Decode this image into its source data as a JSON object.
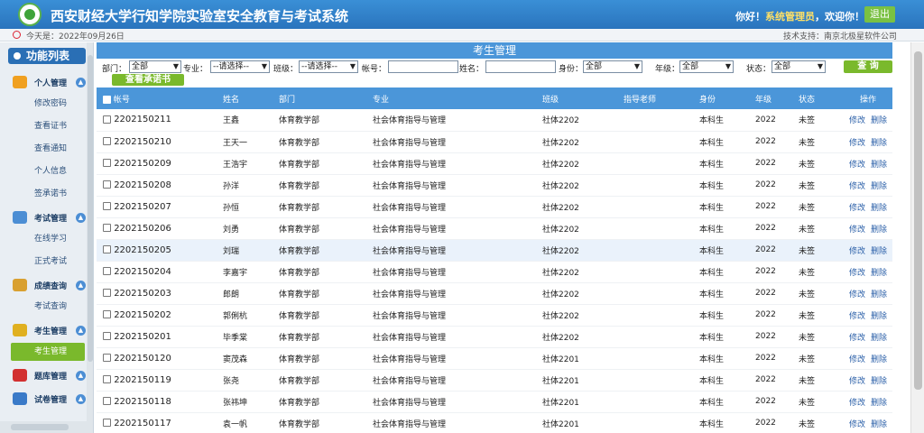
{
  "header": {
    "title": "西安财经大学行知学院实验室安全教育与考试系统",
    "greeting_prefix": "你好！",
    "role": "系统管理员",
    "greeting_suffix": "，欢迎你！",
    "logout_label": "退出"
  },
  "infobar": {
    "today": "今天是：2022年09月26日",
    "support": "技术支持：南京北极星软件公司"
  },
  "sidebar": {
    "title": "功能列表",
    "sections": [
      {
        "label": "个人管理",
        "icon": "person-pencil-icon",
        "items": [
          "修改密码",
          "查看证书",
          "查看通知",
          "个人信息",
          "签承诺书"
        ]
      },
      {
        "label": "考试管理",
        "icon": "people-exam-icon",
        "items": [
          "在线学习",
          "正式考试"
        ]
      },
      {
        "label": "成绩查询",
        "icon": "people-score-icon",
        "items": [
          "考试查询"
        ]
      },
      {
        "label": "考生管理",
        "icon": "lock-people-icon",
        "items": [
          "考生管理"
        ]
      },
      {
        "label": "题库管理",
        "icon": "question-bank-icon",
        "items": []
      },
      {
        "label": "试卷管理",
        "icon": "paper-people-icon",
        "items": []
      }
    ],
    "active_item": "考生管理"
  },
  "main": {
    "title": "考生管理",
    "filters": {
      "dept_label": "部门：",
      "dept_value": "全部",
      "major_label": "专业：",
      "major_value": "--请选择--",
      "class_label": "班级：",
      "class_value": "--请选择--",
      "account_label": "帐号：",
      "account_value": "",
      "name_label": "姓名：",
      "name_value": "",
      "identity_label": "身份：",
      "identity_value": "全部",
      "grade_label": "年级：",
      "grade_value": "全部",
      "status_label": "状态：",
      "status_value": "全部",
      "search_label": "查 询",
      "pledge_label": "查看承诺书"
    },
    "columns": [
      "帐号",
      "姓名",
      "部门",
      "专业",
      "班级",
      "指导老师",
      "身份",
      "年级",
      "状态",
      "操作"
    ],
    "edit_label": "修改",
    "delete_label": "删除",
    "rows": [
      {
        "account": "2202150211",
        "name": "王鑫",
        "dept": "体育教学部",
        "major": "社会体育指导与管理",
        "class": "社体2202",
        "tutor": "",
        "identity": "本科生",
        "grade": "2022",
        "status": "未签"
      },
      {
        "account": "2202150210",
        "name": "王天一",
        "dept": "体育教学部",
        "major": "社会体育指导与管理",
        "class": "社体2202",
        "tutor": "",
        "identity": "本科生",
        "grade": "2022",
        "status": "未签"
      },
      {
        "account": "2202150209",
        "name": "王浩宇",
        "dept": "体育教学部",
        "major": "社会体育指导与管理",
        "class": "社体2202",
        "tutor": "",
        "identity": "本科生",
        "grade": "2022",
        "status": "未签"
      },
      {
        "account": "2202150208",
        "name": "孙洋",
        "dept": "体育教学部",
        "major": "社会体育指导与管理",
        "class": "社体2202",
        "tutor": "",
        "identity": "本科生",
        "grade": "2022",
        "status": "未签"
      },
      {
        "account": "2202150207",
        "name": "孙恒",
        "dept": "体育教学部",
        "major": "社会体育指导与管理",
        "class": "社体2202",
        "tutor": "",
        "identity": "本科生",
        "grade": "2022",
        "status": "未签"
      },
      {
        "account": "2202150206",
        "name": "刘勇",
        "dept": "体育教学部",
        "major": "社会体育指导与管理",
        "class": "社体2202",
        "tutor": "",
        "identity": "本科生",
        "grade": "2022",
        "status": "未签"
      },
      {
        "account": "2202150205",
        "name": "刘瑞",
        "dept": "体育教学部",
        "major": "社会体育指导与管理",
        "class": "社体2202",
        "tutor": "",
        "identity": "本科生",
        "grade": "2022",
        "status": "未签"
      },
      {
        "account": "2202150204",
        "name": "李嘉宇",
        "dept": "体育教学部",
        "major": "社会体育指导与管理",
        "class": "社体2202",
        "tutor": "",
        "identity": "本科生",
        "grade": "2022",
        "status": "未签"
      },
      {
        "account": "2202150203",
        "name": "郎朗",
        "dept": "体育教学部",
        "major": "社会体育指导与管理",
        "class": "社体2202",
        "tutor": "",
        "identity": "本科生",
        "grade": "2022",
        "status": "未签"
      },
      {
        "account": "2202150202",
        "name": "郭俐杭",
        "dept": "体育教学部",
        "major": "社会体育指导与管理",
        "class": "社体2202",
        "tutor": "",
        "identity": "本科生",
        "grade": "2022",
        "status": "未签"
      },
      {
        "account": "2202150201",
        "name": "毕季棠",
        "dept": "体育教学部",
        "major": "社会体育指导与管理",
        "class": "社体2202",
        "tutor": "",
        "identity": "本科生",
        "grade": "2022",
        "status": "未签"
      },
      {
        "account": "2202150120",
        "name": "窦茂森",
        "dept": "体育教学部",
        "major": "社会体育指导与管理",
        "class": "社体2201",
        "tutor": "",
        "identity": "本科生",
        "grade": "2022",
        "status": "未签"
      },
      {
        "account": "2202150119",
        "name": "张尧",
        "dept": "体育教学部",
        "major": "社会体育指导与管理",
        "class": "社体2201",
        "tutor": "",
        "identity": "本科生",
        "grade": "2022",
        "status": "未签"
      },
      {
        "account": "2202150118",
        "name": "张祎坤",
        "dept": "体育教学部",
        "major": "社会体育指导与管理",
        "class": "社体2201",
        "tutor": "",
        "identity": "本科生",
        "grade": "2022",
        "status": "未签"
      },
      {
        "account": "2202150117",
        "name": "袁一帆",
        "dept": "体育教学部",
        "major": "社会体育指导与管理",
        "class": "社体2201",
        "tutor": "",
        "identity": "本科生",
        "grade": "2022",
        "status": "未签"
      }
    ],
    "highlight_row_index": 6
  },
  "colors": {
    "header_blue": "#2a74bd",
    "table_header": "#4b96d9",
    "accent_green": "#7ab92c",
    "link_blue": "#2a5fa8"
  }
}
